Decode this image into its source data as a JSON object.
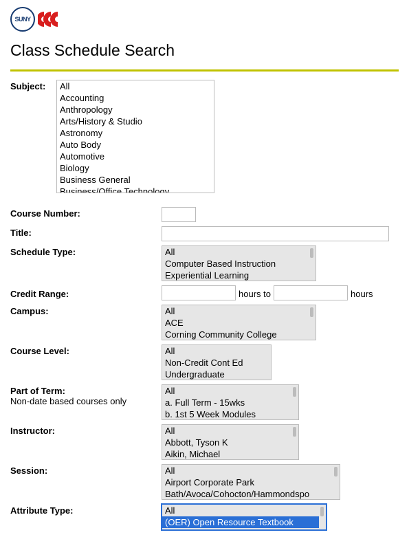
{
  "brand": {
    "suny": "SUNY"
  },
  "page_title": "Class Schedule Search",
  "subject": {
    "label": "Subject:",
    "options": [
      "All",
      "Accounting",
      "Anthropology",
      "Arts/History & Studio",
      "Astronomy",
      "Auto Body",
      "Automotive",
      "Biology",
      "Business General",
      "Business/Office Technology"
    ]
  },
  "course_number": {
    "label": "Course Number:",
    "value": ""
  },
  "title_field": {
    "label": "Title:",
    "value": ""
  },
  "schedule_type": {
    "label": "Schedule Type:",
    "options": [
      "All",
      "Computer Based Instruction",
      "Experiential Learning"
    ]
  },
  "credit_range": {
    "label": "Credit Range:",
    "hours_word": "hours",
    "to_word": "to",
    "low": "",
    "high": ""
  },
  "campus": {
    "label": "Campus:",
    "options": [
      "All",
      "ACE",
      "Corning Community College"
    ]
  },
  "course_level": {
    "label": "Course Level:",
    "options": [
      "All",
      "Non-Credit Cont Ed",
      "Undergraduate"
    ]
  },
  "part_of_term": {
    "label": "Part of Term:",
    "subnote": "Non-date based courses only",
    "options": [
      "All",
      "a. Full Term - 15wks",
      "b. 1st 5 Week Modules"
    ]
  },
  "instructor": {
    "label": "Instructor:",
    "options": [
      "All",
      "Abbott, Tyson K",
      "Aikin, Michael"
    ]
  },
  "session": {
    "label": "Session:",
    "options": [
      "All",
      "Airport Corporate Park",
      "Bath/Avoca/Cohocton/Hammondspo"
    ]
  },
  "attribute_type": {
    "label": "Attribute Type:",
    "selected_index": 1,
    "options": [
      "All",
      "(OER) Open Resource Textbook"
    ]
  }
}
